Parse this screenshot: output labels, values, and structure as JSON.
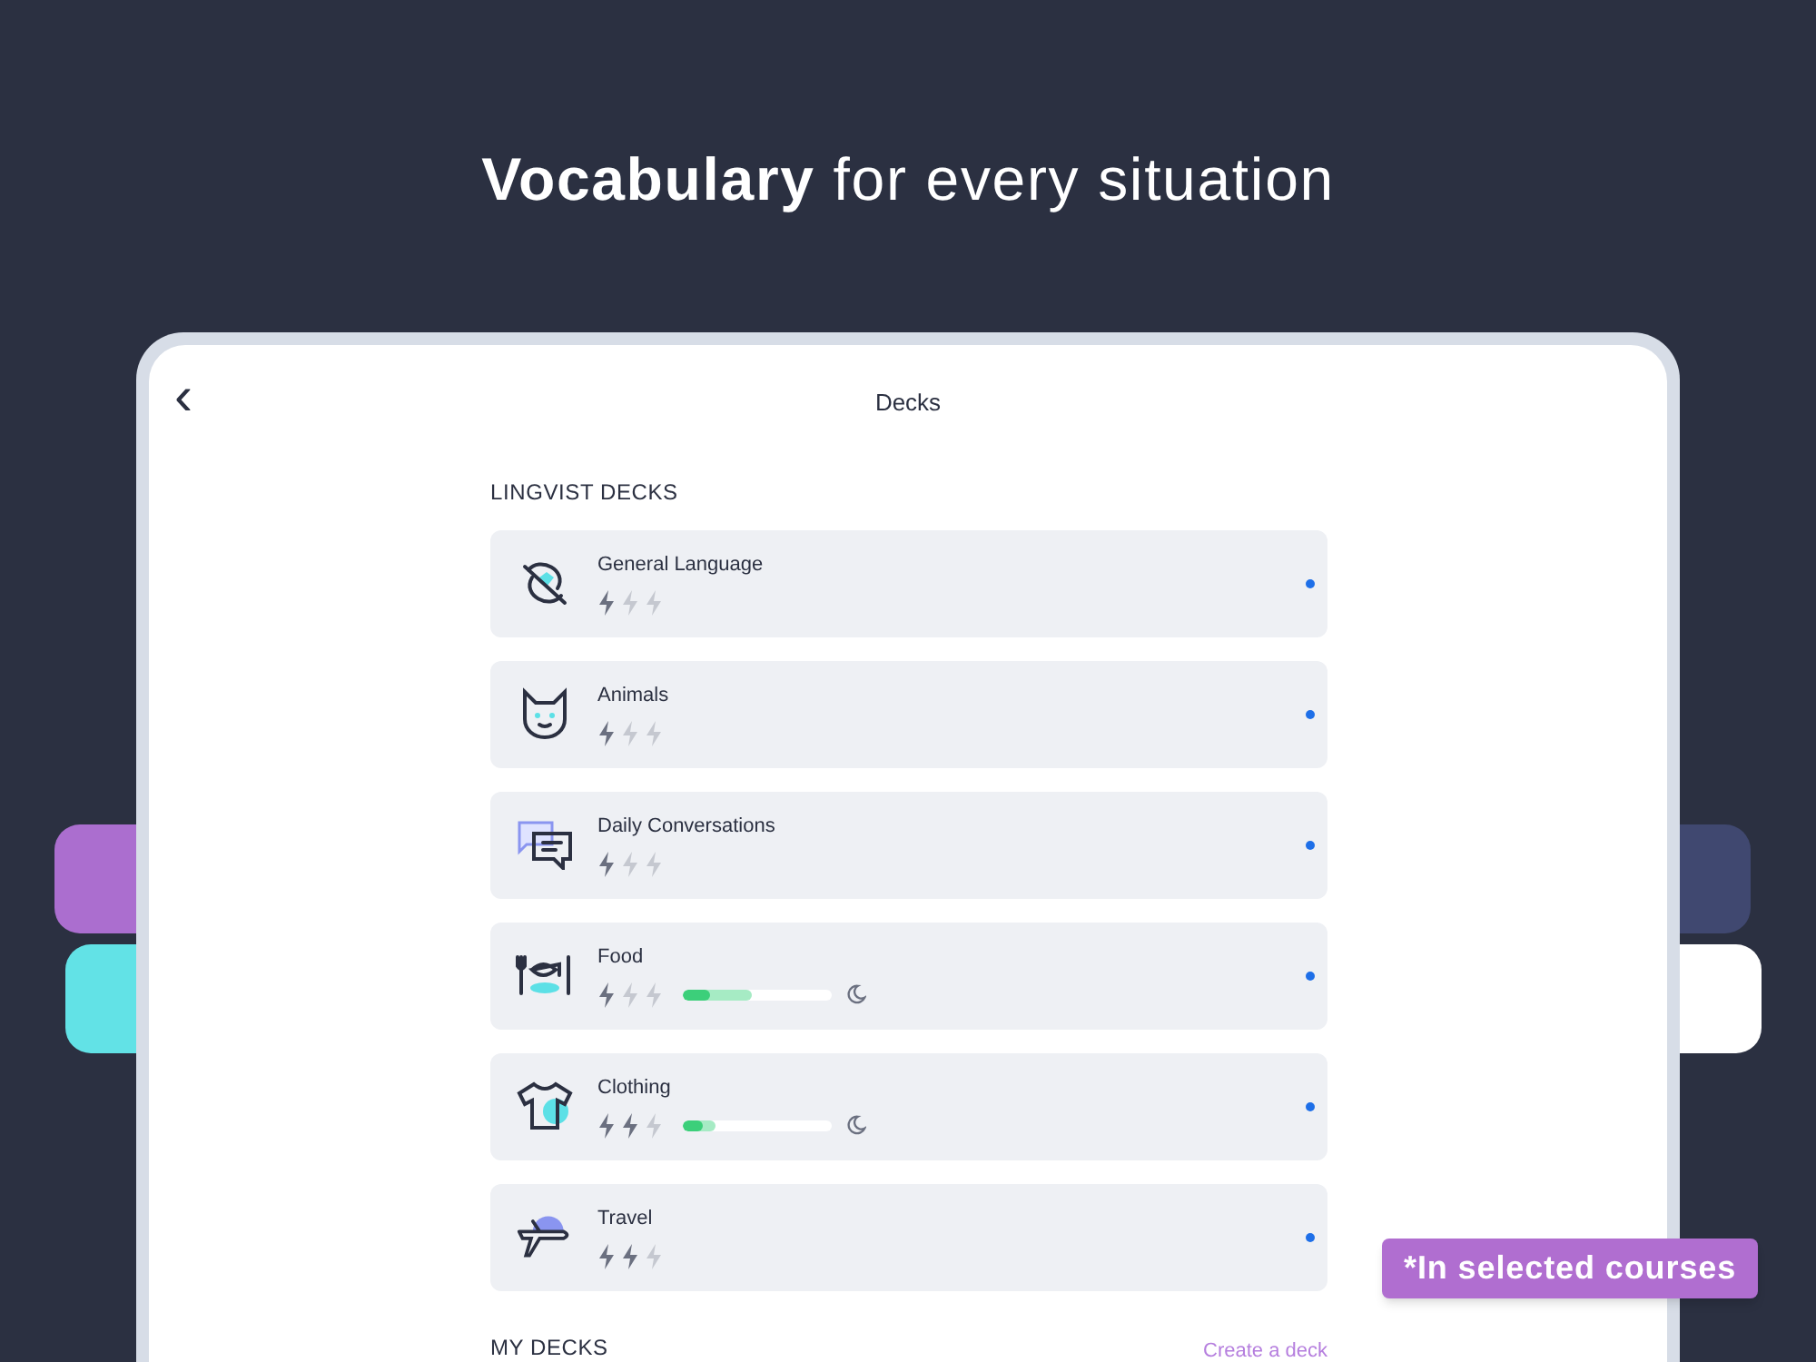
{
  "headline": "**Vocabulary** for every situation",
  "screen": {
    "back": "‹",
    "title": "Decks"
  },
  "lingvist_section": {
    "heading": "LINGVIST DECKS"
  },
  "decks": [
    {
      "kind": "general",
      "name": "General Language",
      "stars": 1,
      "marked": true
    },
    {
      "kind": "animals",
      "name": "Animals",
      "stars": 1,
      "marked": true
    },
    {
      "kind": "conversations",
      "name": "Daily Conversations",
      "stars": 1,
      "marked": true
    },
    {
      "kind": "food",
      "name": "Food",
      "stars": 1,
      "marked": true,
      "progress": [
        {
          "kind": "learned",
          "level": 0.18
        },
        {
          "kind": "seen",
          "level": 0.46
        }
      ]
    },
    {
      "kind": "clothing",
      "name": "Clothing",
      "stars": 2,
      "marked": true,
      "progress": [
        {
          "kind": "learned",
          "level": 0.13
        },
        {
          "kind": "seen",
          "level": 0.22
        }
      ]
    },
    {
      "kind": "travel",
      "name": "Travel",
      "stars": 2,
      "marked": true
    }
  ],
  "my_section": {
    "heading": "MY DECKS",
    "action": "Create a deck"
  },
  "badge": "*In selected courses"
}
